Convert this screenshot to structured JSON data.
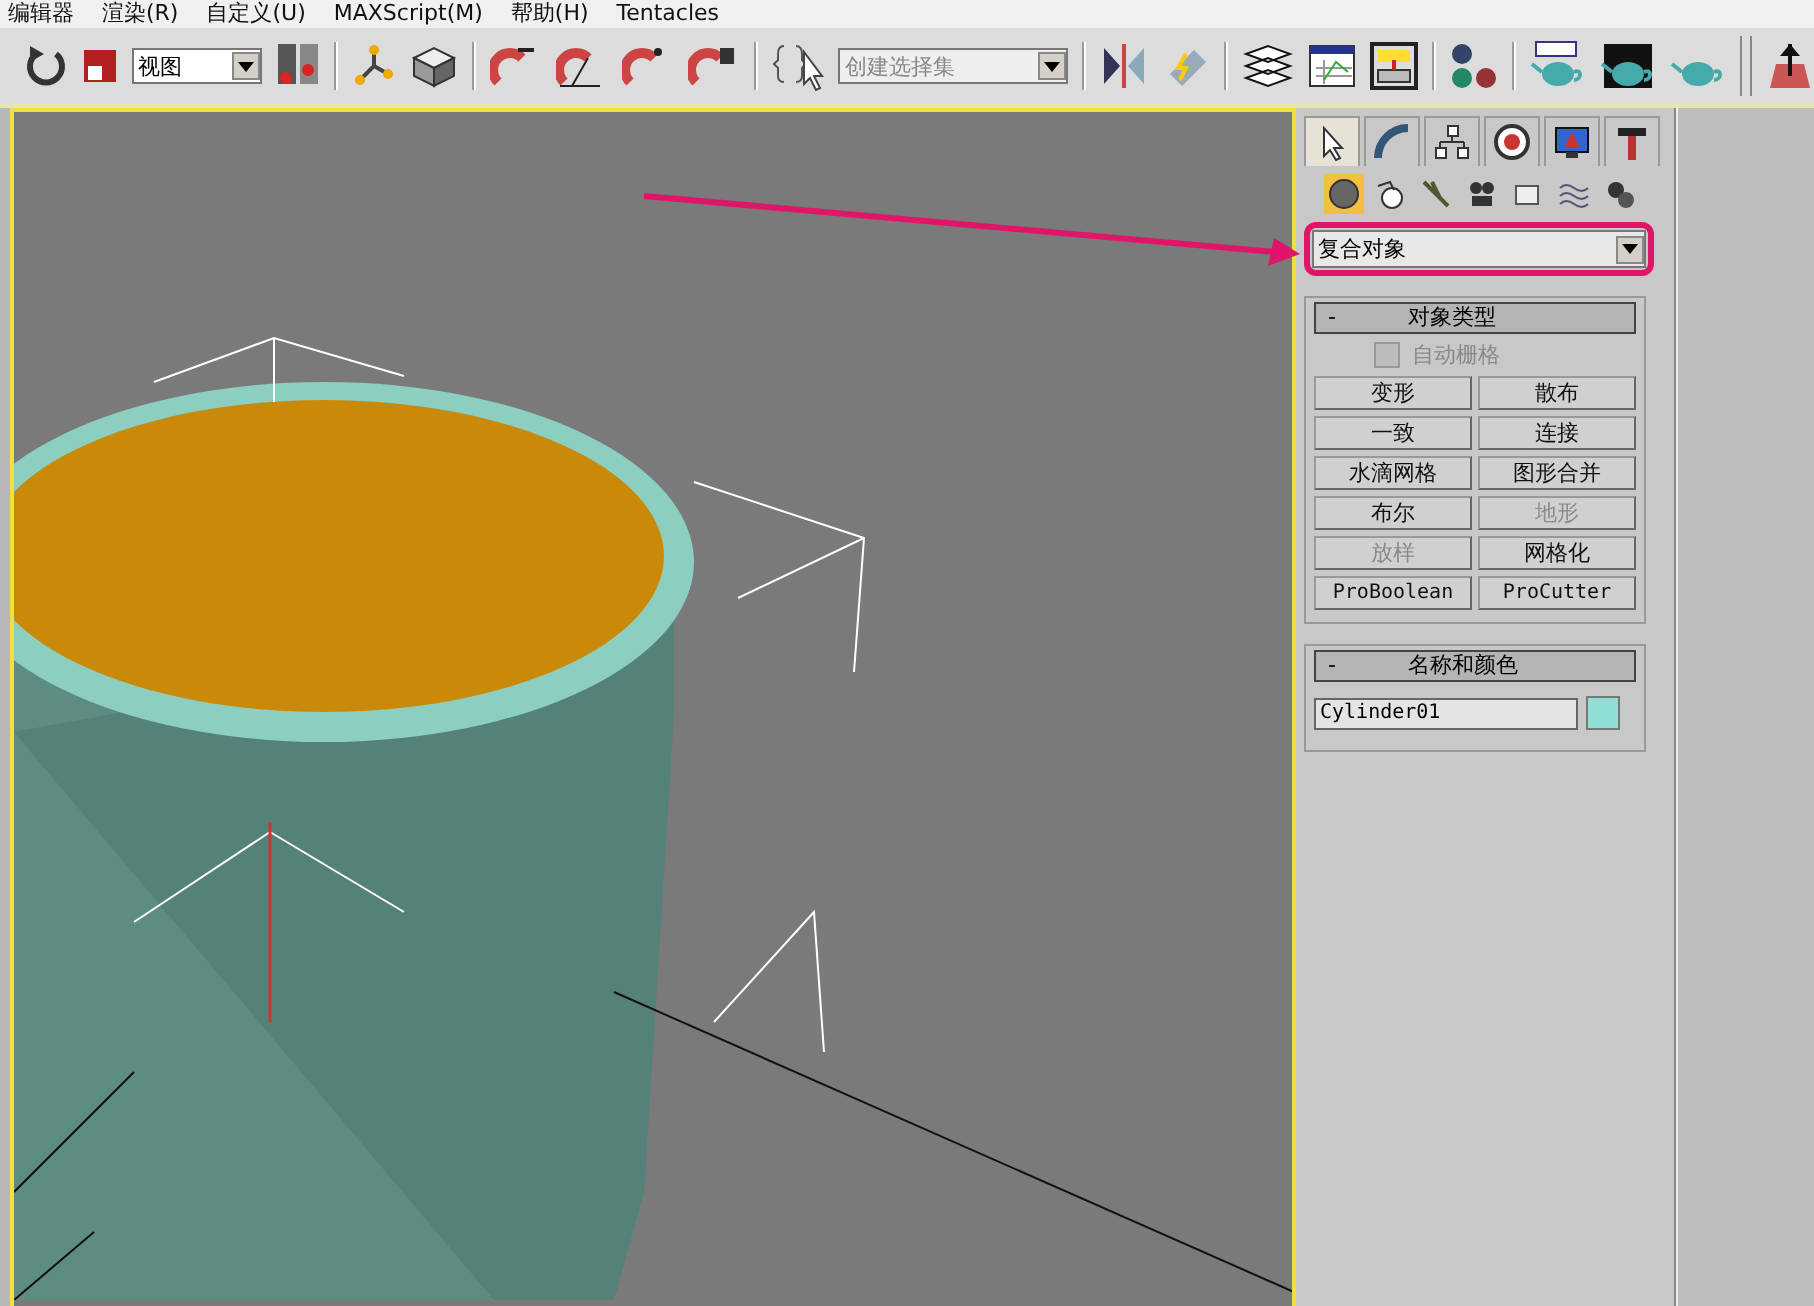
{
  "menu": [
    {
      "label": "编辑器"
    },
    {
      "label": "渲染(R)"
    },
    {
      "label": "自定义(U)"
    },
    {
      "label": "MAXScript(M)"
    },
    {
      "label": "帮助(H)"
    },
    {
      "label": "Tentacles"
    }
  ],
  "toolbar": {
    "view_dropdown": "视图",
    "selection_set": {
      "placeholder": "创建选择集"
    }
  },
  "command_tabs": [
    {
      "selected": true
    },
    {
      "selected": false
    },
    {
      "selected": false
    },
    {
      "selected": false
    },
    {
      "selected": false
    },
    {
      "selected": false
    }
  ],
  "categories": [
    {
      "selected": true
    },
    {
      "selected": false
    },
    {
      "selected": false
    },
    {
      "selected": false
    },
    {
      "selected": false
    },
    {
      "selected": false
    },
    {
      "selected": false
    }
  ],
  "object_category": "复合对象",
  "object_type": {
    "title": "对象类型",
    "minus": "-",
    "autogrid": {
      "label": "自动栅格",
      "checked": false,
      "disabled": true
    },
    "buttons": [
      {
        "label": "变形",
        "disabled": false,
        "kind": "cjk"
      },
      {
        "label": "散布",
        "disabled": false,
        "kind": "cjk"
      },
      {
        "label": "一致",
        "disabled": false,
        "kind": "cjk"
      },
      {
        "label": "连接",
        "disabled": false,
        "kind": "cjk"
      },
      {
        "label": "水滴网格",
        "disabled": false,
        "kind": "cjk"
      },
      {
        "label": "图形合并",
        "disabled": false,
        "kind": "cjk"
      },
      {
        "label": "布尔",
        "disabled": false,
        "kind": "cjk"
      },
      {
        "label": "地形",
        "disabled": true,
        "kind": "cjk"
      },
      {
        "label": "放样",
        "disabled": true,
        "kind": "cjk"
      },
      {
        "label": "网格化",
        "disabled": false,
        "kind": "cjk"
      },
      {
        "label": "ProBoolean",
        "disabled": false,
        "kind": "mono"
      },
      {
        "label": "ProCutter",
        "disabled": false,
        "kind": "mono"
      }
    ]
  },
  "name_and_color": {
    "title": "名称和颜色",
    "minus": "-",
    "name": "Cylinder01",
    "color": "#8ee0d4"
  }
}
